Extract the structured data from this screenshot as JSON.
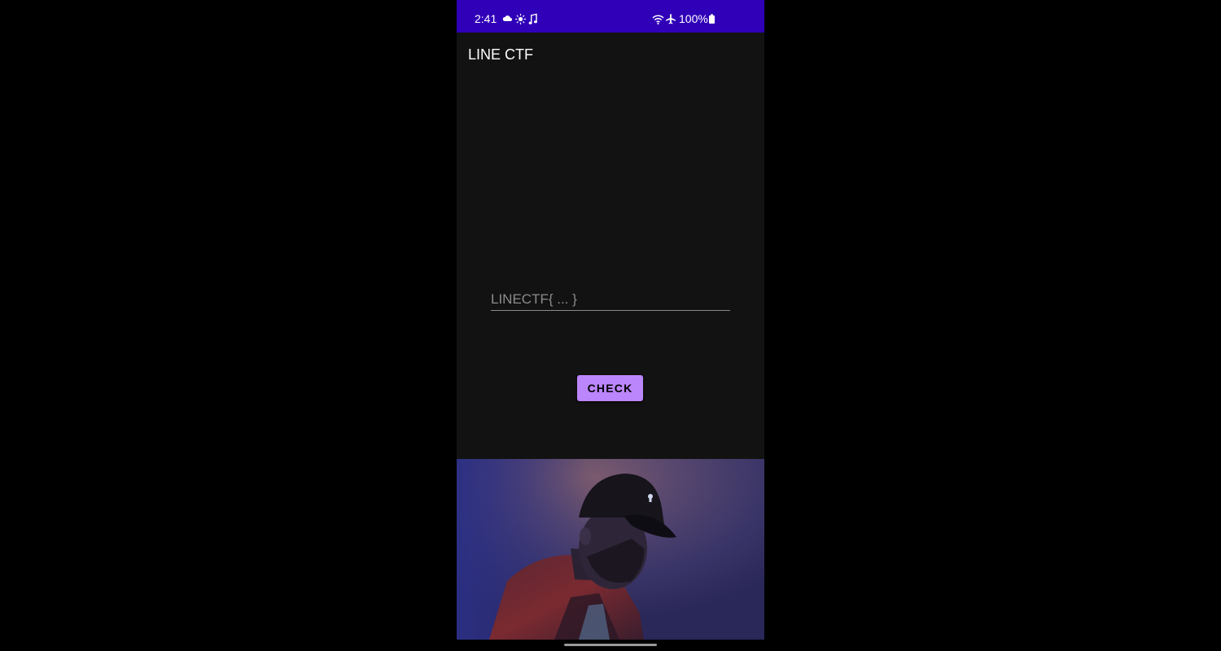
{
  "status_bar": {
    "time": "2:41",
    "battery": "100%",
    "background": "#3000b8",
    "left_icons": [
      "cloud-icon",
      "sun-icon",
      "music-note-icon"
    ],
    "right_icons": [
      "wifi-icon",
      "airplane-mode-icon",
      "battery-icon"
    ]
  },
  "app": {
    "title": "LINE CTF"
  },
  "flag_input": {
    "placeholder": "LINECTF{ ... }",
    "value": ""
  },
  "check_button": {
    "label": "CHECK",
    "color": "#bb86fc"
  }
}
